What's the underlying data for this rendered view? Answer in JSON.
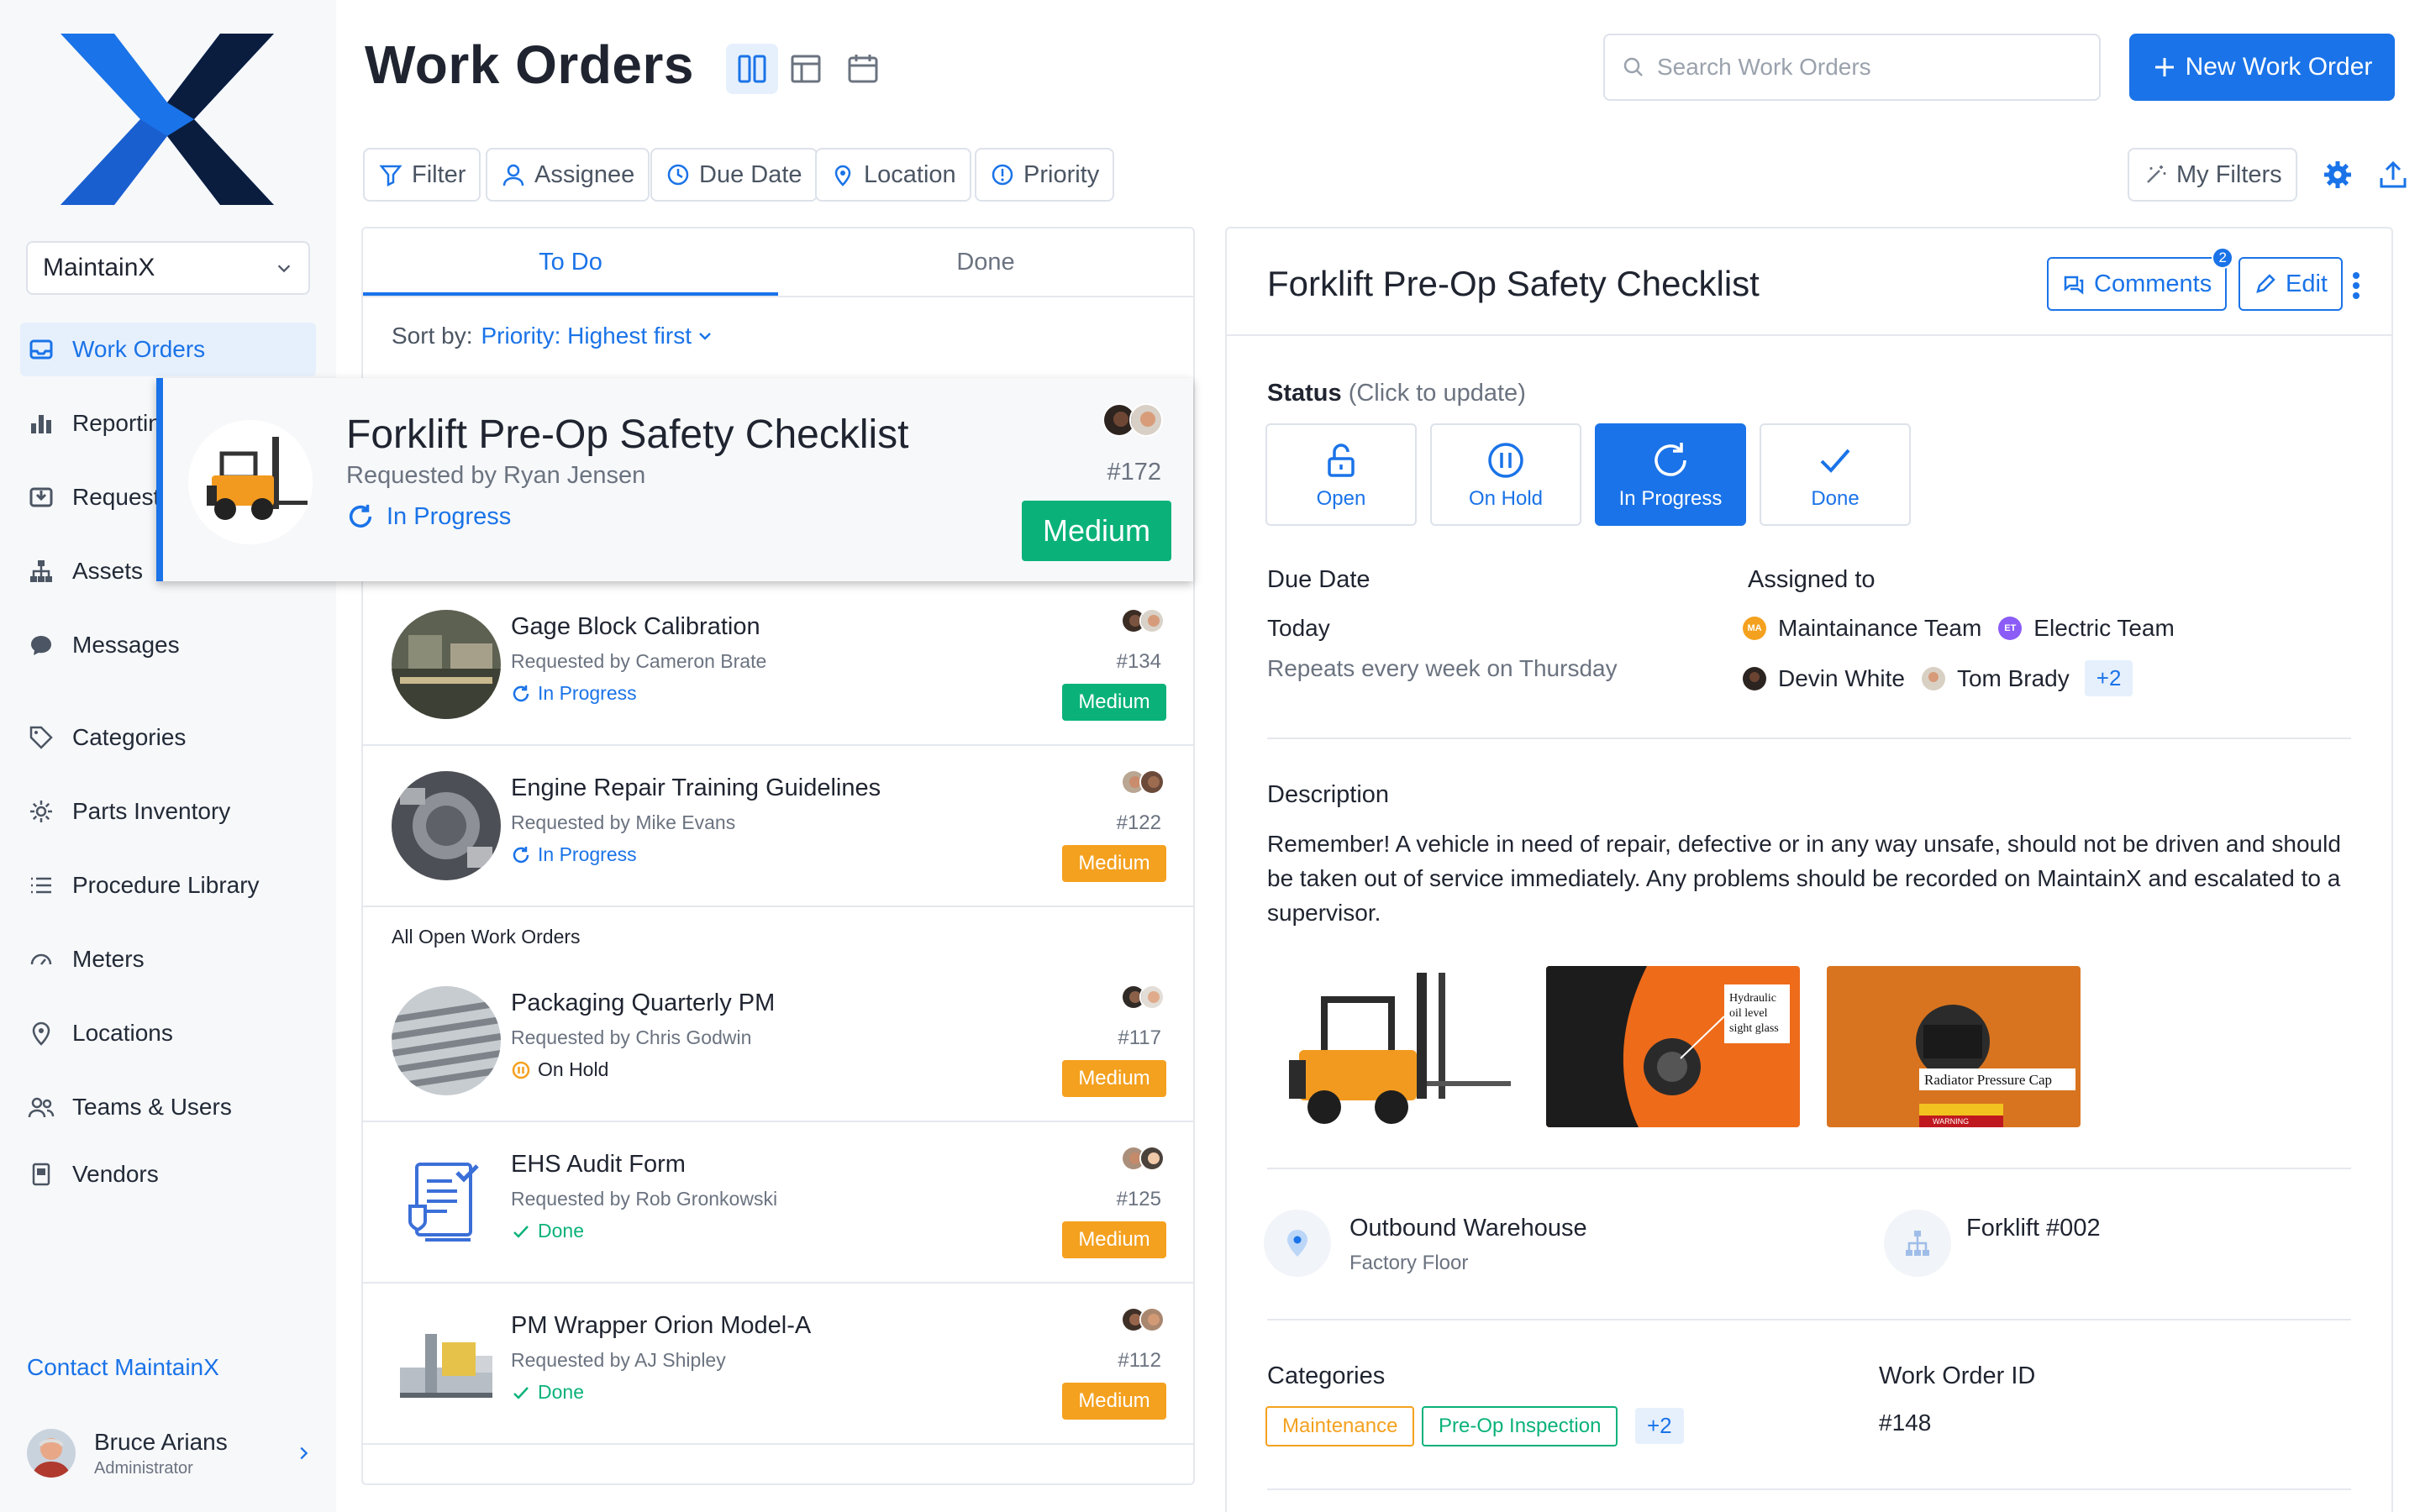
{
  "app": {
    "org_name": "MaintainX",
    "contact_link": "Contact MaintainX"
  },
  "sidebar": {
    "items": [
      {
        "label": "Work Orders",
        "icon": "inbox-icon",
        "active": true
      },
      {
        "label": "Reporting",
        "icon": "bar-chart-icon"
      },
      {
        "label": "Requests",
        "icon": "tray-in-icon"
      },
      {
        "label": "Assets",
        "icon": "hierarchy-icon"
      },
      {
        "label": "Messages",
        "icon": "chat-icon"
      },
      {
        "label": "Categories",
        "icon": "tag-icon"
      },
      {
        "label": "Parts Inventory",
        "icon": "gear-icon"
      },
      {
        "label": "Procedure Library",
        "icon": "list-icon"
      },
      {
        "label": "Meters",
        "icon": "gauge-icon"
      },
      {
        "label": "Locations",
        "icon": "map-pin-icon"
      },
      {
        "label": "Teams & Users",
        "icon": "users-icon"
      },
      {
        "label": "Vendors",
        "icon": "vendor-icon"
      }
    ]
  },
  "user": {
    "name": "Bruce Arians",
    "role": "Administrator"
  },
  "header": {
    "title": "Work Orders",
    "search_placeholder": "Search Work Orders",
    "new_button": "New Work Order",
    "filters": [
      "Filter",
      "Assignee",
      "Due Date",
      "Location",
      "Priority"
    ],
    "my_filters": "My Filters"
  },
  "list": {
    "tabs": [
      "To Do",
      "Done"
    ],
    "sort_label": "Sort by:",
    "sort_value": "Priority: Highest first",
    "section_label": "All Open Work Orders",
    "selected": {
      "title": "Forklift Pre-Op Safety Checklist",
      "requested_by": "Requested by Ryan Jensen",
      "status": "In Progress",
      "id": "#172",
      "priority": "Medium"
    },
    "rows": [
      {
        "title": "Gage Block Calibration",
        "requested_by": "Requested by Cameron Brate",
        "status": "In Progress",
        "id": "#134",
        "priority": "Medium",
        "priority_color": "#0ab27a"
      },
      {
        "title": "Engine Repair Training Guidelines",
        "requested_by": "Requested by Mike Evans",
        "status": "In Progress",
        "id": "#122",
        "priority": "Medium",
        "priority_color": "#f4a11f"
      },
      {
        "title": "Packaging Quarterly PM",
        "requested_by": "Requested by Chris Godwin",
        "status": "On Hold",
        "id": "#117",
        "priority": "Medium",
        "priority_color": "#f4a11f"
      },
      {
        "title": "EHS Audit Form",
        "requested_by": "Requested by Rob Gronkowski",
        "status": "Done",
        "id": "#125",
        "priority": "Medium",
        "priority_color": "#f4a11f"
      },
      {
        "title": "PM Wrapper Orion Model-A",
        "requested_by": "Requested by AJ Shipley",
        "status": "Done",
        "id": "#112",
        "priority": "Medium",
        "priority_color": "#f4a11f"
      }
    ]
  },
  "detail": {
    "title": "Forklift Pre-Op Safety Checklist",
    "comments_label": "Comments",
    "comments_count": "2",
    "edit_label": "Edit",
    "status_label": "Status",
    "status_hint": "(Click to update)",
    "statuses": [
      "Open",
      "On Hold",
      "In Progress",
      "Done"
    ],
    "due_date_label": "Due Date",
    "due_date": "Today",
    "repeat": "Repeats every week on Thursday",
    "assigned_label": "Assigned to",
    "teams": [
      {
        "name": "Maintainance Team",
        "initials": "MA",
        "color": "#f4a11f"
      },
      {
        "name": "Electric Team",
        "initials": "ET",
        "color": "#8b5cf6"
      }
    ],
    "people": [
      "Devin White",
      "Tom Brady"
    ],
    "more_assignees": "+2",
    "description_label": "Description",
    "description": "Remember! A vehicle in need of repair, defective or in any way unsafe, should not be driven and should be taken out of service immediately. Any problems should be recorded on MaintainX and escalated to a supervisor.",
    "photo_labels": [
      "Hydraulic oil level sight glass",
      "Radiator Pressure Cap",
      "WARNING"
    ],
    "location_name": "Outbound Warehouse",
    "location_sub": "Factory Floor",
    "asset_name": "Forklift #002",
    "categories_label": "Categories",
    "categories": [
      "Maintenance",
      "Pre-Op Inspection"
    ],
    "categories_more": "+2",
    "wo_id_label": "Work Order ID",
    "wo_id": "#148"
  },
  "colors": {
    "accent": "#1a73e8",
    "green": "#0ab27a",
    "orange": "#f4a11f",
    "sidebar_bg": "#f7f8fa"
  }
}
